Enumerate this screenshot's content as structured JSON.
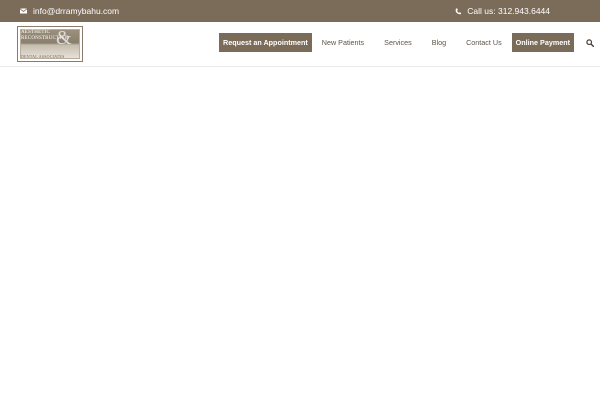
{
  "topbar": {
    "email": "info@drramybahu.com",
    "phone": "Call us: 312.943.6444",
    "email_icon": "envelope-icon",
    "phone_icon": "phone-icon"
  },
  "logo": {
    "line1": "AESTHETIC",
    "line2": "RECONSTRUCTIVE",
    "line3": "DENTAL ASSOCIATES",
    "ampersand": "&"
  },
  "nav": {
    "request_label": "Request an Appointment",
    "new_patients_label": "New Patients",
    "services_label": "Services",
    "blog_label": "Blog",
    "contact_label": "Contact Us",
    "payment_label": "Online Payment",
    "search_icon": "search-icon"
  },
  "colors": {
    "brand": "#7b6c59",
    "nav_text": "#5e5346"
  }
}
